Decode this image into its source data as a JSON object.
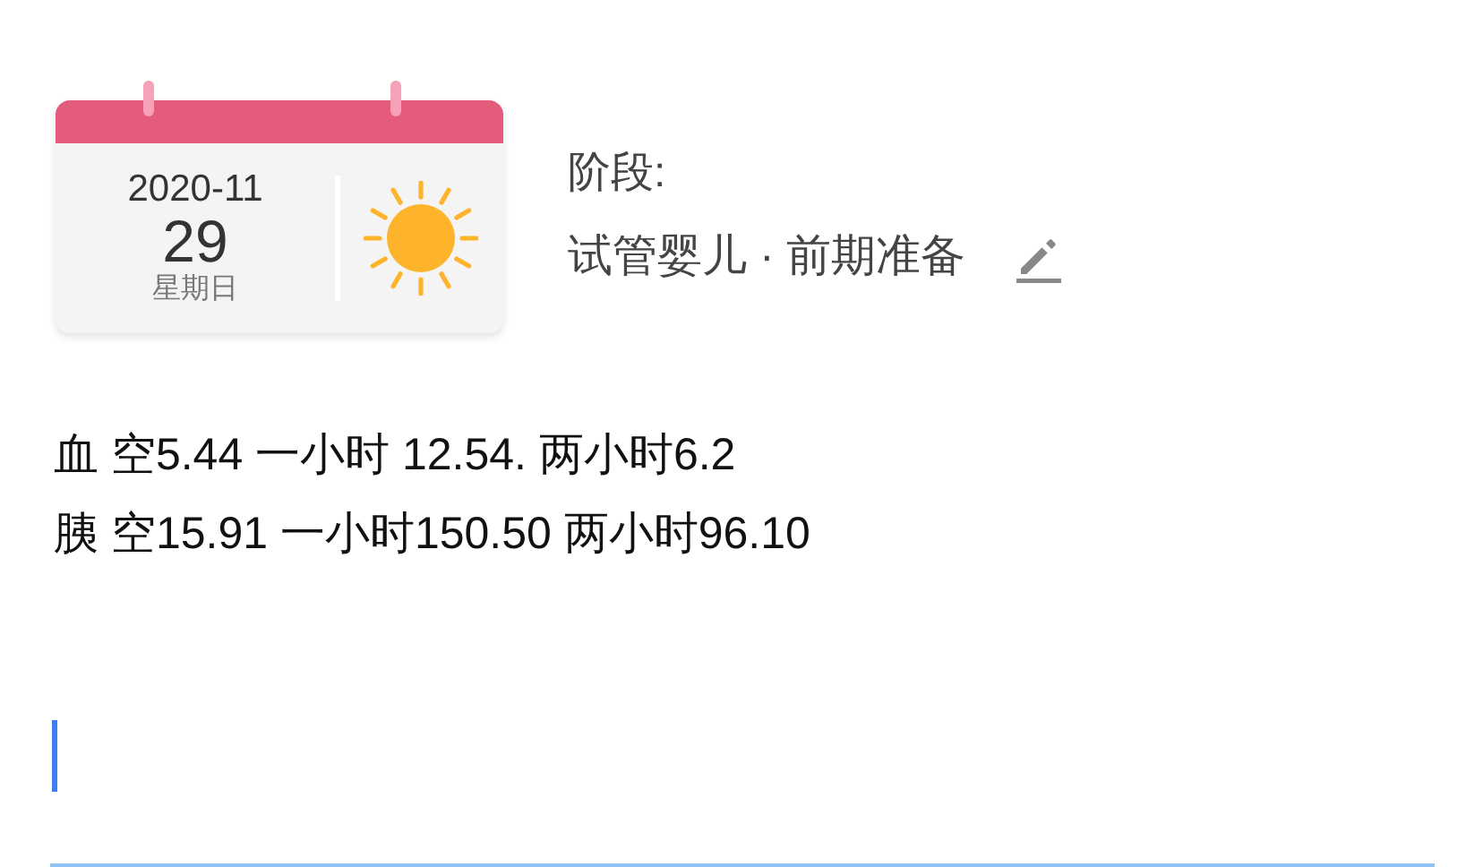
{
  "calendar": {
    "year_month": "2020-11",
    "day": "29",
    "weekday": "星期日",
    "weather": {
      "kind": "sunny"
    }
  },
  "stage": {
    "label": "阶段:",
    "value": "试管婴儿 · 前期准备"
  },
  "note": {
    "lines": [
      "血 空5.44 一小时 12.54. 两小时6.2",
      "胰 空15.91 一小时150.50 两小时96.10"
    ]
  },
  "input": {
    "focused": true
  }
}
